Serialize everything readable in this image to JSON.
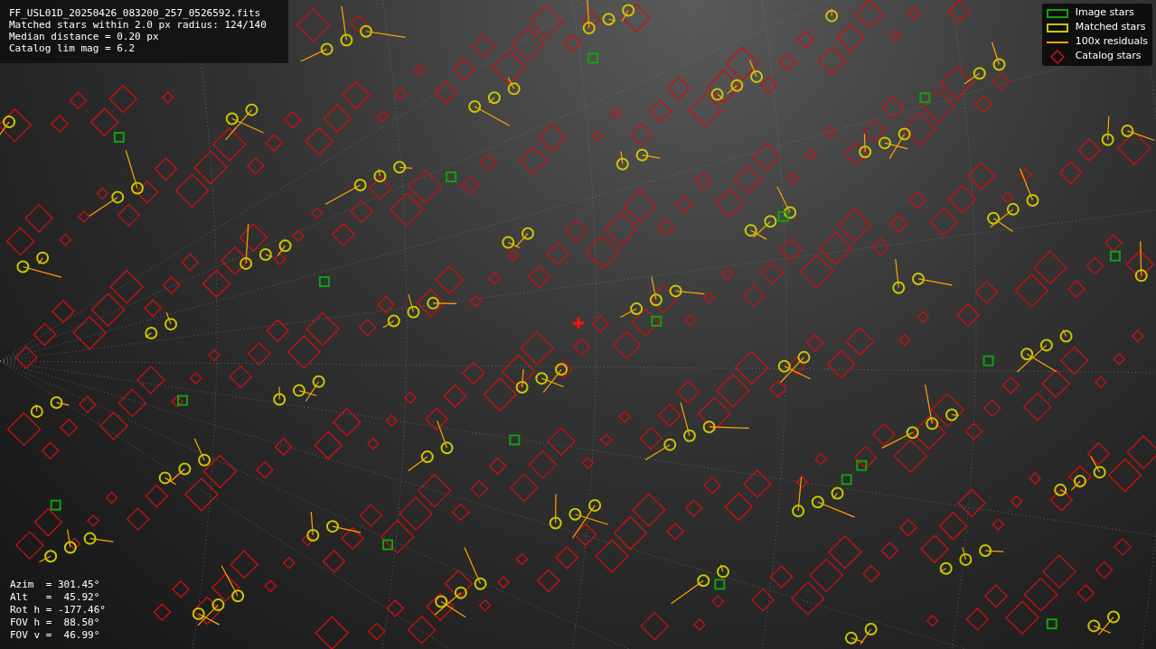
{
  "info_box": {
    "lines": [
      "FF_USL01D_20250426_083200_257_0526592.fits",
      "Matched stars within 2.0 px radius: 124/140",
      "Median distance = 0.20 px",
      "Catalog lim mag = 6.2"
    ]
  },
  "legend": {
    "items": [
      {
        "kind": "image",
        "label": "Image stars",
        "color": "#10a010"
      },
      {
        "kind": "matched",
        "label": "Matched stars",
        "color": "#c8c800"
      },
      {
        "kind": "residual",
        "label": "100x residuals",
        "color": "#ffa500"
      },
      {
        "kind": "catalog",
        "label": "Catalog stars",
        "color": "#cc1010"
      }
    ]
  },
  "pointing": {
    "lines": [
      "Azim  = 301.45°",
      "Alt   =  45.92°",
      "Rot h = -177.46°",
      "FOV h =  88.50°",
      "FOV v =  46.99°"
    ]
  }
}
